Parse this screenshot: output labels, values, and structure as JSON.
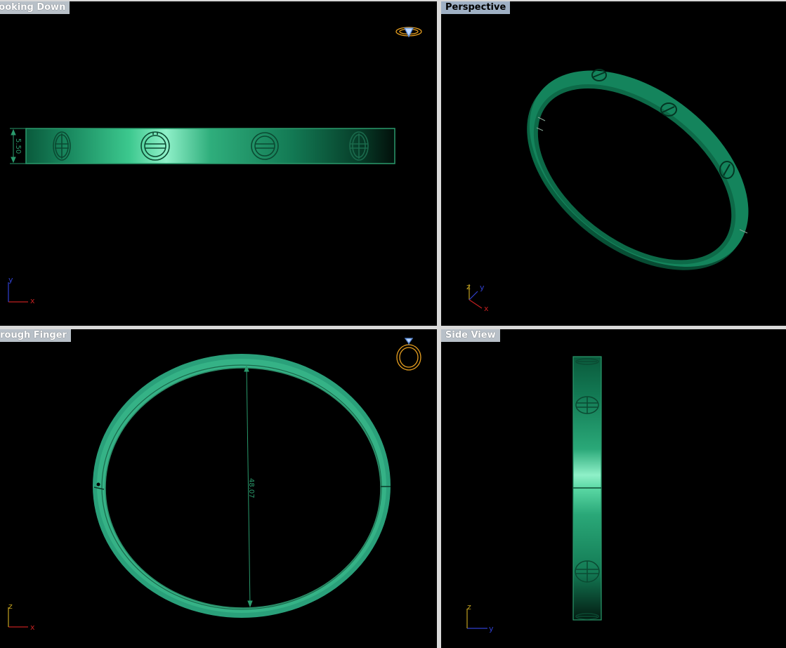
{
  "viewports": {
    "top_left": {
      "title": "Looking Down",
      "active": false
    },
    "top_right": {
      "title": "Perspective",
      "active": true
    },
    "bottom_left": {
      "title": "Through Finger",
      "active": false
    },
    "bottom_right": {
      "title": "Side View",
      "active": false
    }
  },
  "dimensions": {
    "width_label": "5.50",
    "diameter_label": "48.07"
  },
  "axes": {
    "top_left": {
      "vertical": "y",
      "horizontal": "x"
    },
    "top_right": {
      "vertical": "z",
      "depth": "y",
      "horizontal": "x"
    },
    "bottom_left": {
      "vertical": "z",
      "horizontal": "x"
    },
    "bottom_right": {
      "vertical": "z",
      "horizontal": "y"
    }
  },
  "colors": {
    "model_green": "#1f9a6e",
    "model_highlight": "#8ff0c8",
    "model_dark": "#063d2a",
    "axis_x": "#c02020",
    "axis_y": "#3040d0",
    "axis_z": "#c0a020",
    "cplane_icon": "#e8a020"
  }
}
